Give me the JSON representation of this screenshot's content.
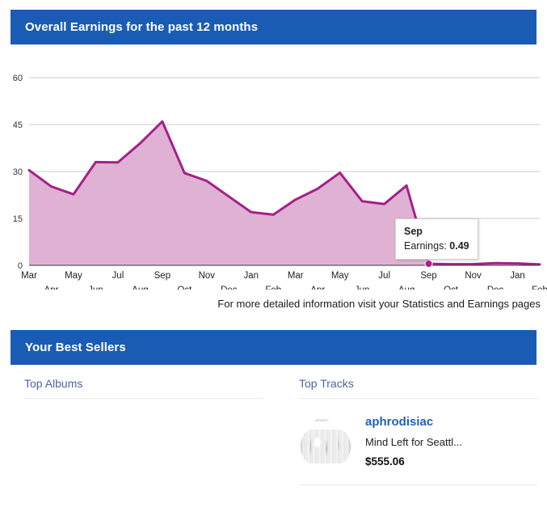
{
  "earnings_panel": {
    "title": "Overall Earnings for the past 12 months"
  },
  "chart_footer": "For more detailed information visit your Statistics and Earnings pages",
  "tooltip": {
    "title": "Sep",
    "label": "Earnings:",
    "value": "0.49"
  },
  "best_sellers_panel": {
    "title": "Your Best Sellers"
  },
  "columns": {
    "albums_title": "Top Albums",
    "tracks_title": "Top Tracks"
  },
  "top_tracks": [
    {
      "artist": "aphrodisiac",
      "track": "Mind Left for Seattl...",
      "price": "$555.06",
      "art_caption": "APHRO..."
    }
  ],
  "colors": {
    "brand_blue": "#1a5cb3",
    "line_magenta": "#a6208a",
    "area_pink": "#dfb2d3",
    "grid": "#cccccc",
    "axis": "#4d4d4d",
    "column_title": "#4f63a8",
    "link_blue": "#2461b5"
  },
  "chart_data": {
    "type": "area",
    "title": "Overall Earnings for the past 12 months",
    "xlabel": "",
    "ylabel": "",
    "ylim": [
      0,
      60
    ],
    "yticks": [
      0,
      15,
      30,
      45,
      60
    ],
    "grid": true,
    "legend": "none",
    "categories": [
      "Mar",
      "Apr",
      "May",
      "Jun",
      "Jul",
      "Aug",
      "Sep",
      "Oct",
      "Nov",
      "Dec",
      "Jan",
      "Feb",
      "Mar",
      "Apr",
      "May",
      "Jun",
      "Jul",
      "Aug",
      "Sep",
      "Oct",
      "Nov",
      "Dec",
      "Jan",
      "Feb"
    ],
    "tick_labels_top_row": [
      "Mar",
      "May",
      "Jul",
      "Sep",
      "Nov",
      "Jan",
      "Mar",
      "May",
      "Jul",
      "Sep",
      "Nov",
      "Jan"
    ],
    "tick_labels_bottom_row": [
      "Apr",
      "Jun",
      "Aug",
      "Oct",
      "Dec",
      "Feb",
      "Apr",
      "Jun",
      "Aug",
      "Oct",
      "Dec",
      "Feb"
    ],
    "values": [
      30.4,
      25.2,
      22.7,
      33.0,
      32.9,
      39.0,
      46.0,
      29.5,
      27.0,
      22.0,
      17.0,
      16.2,
      21.0,
      24.5,
      29.6,
      20.5,
      19.6,
      25.5,
      0.49,
      0.35,
      0.4,
      0.7,
      0.6,
      0.3
    ],
    "annotations": [
      {
        "x": "Sep",
        "y": 0.49,
        "text": "Sep / Earnings: 0.49",
        "marker": true
      }
    ],
    "series": [
      {
        "name": "Earnings",
        "values": [
          30.4,
          25.2,
          22.7,
          33.0,
          32.9,
          39.0,
          46.0,
          29.5,
          27.0,
          22.0,
          17.0,
          16.2,
          21.0,
          24.5,
          29.6,
          20.5,
          19.6,
          25.5,
          0.49,
          0.35,
          0.4,
          0.7,
          0.6,
          0.3
        ]
      }
    ]
  }
}
